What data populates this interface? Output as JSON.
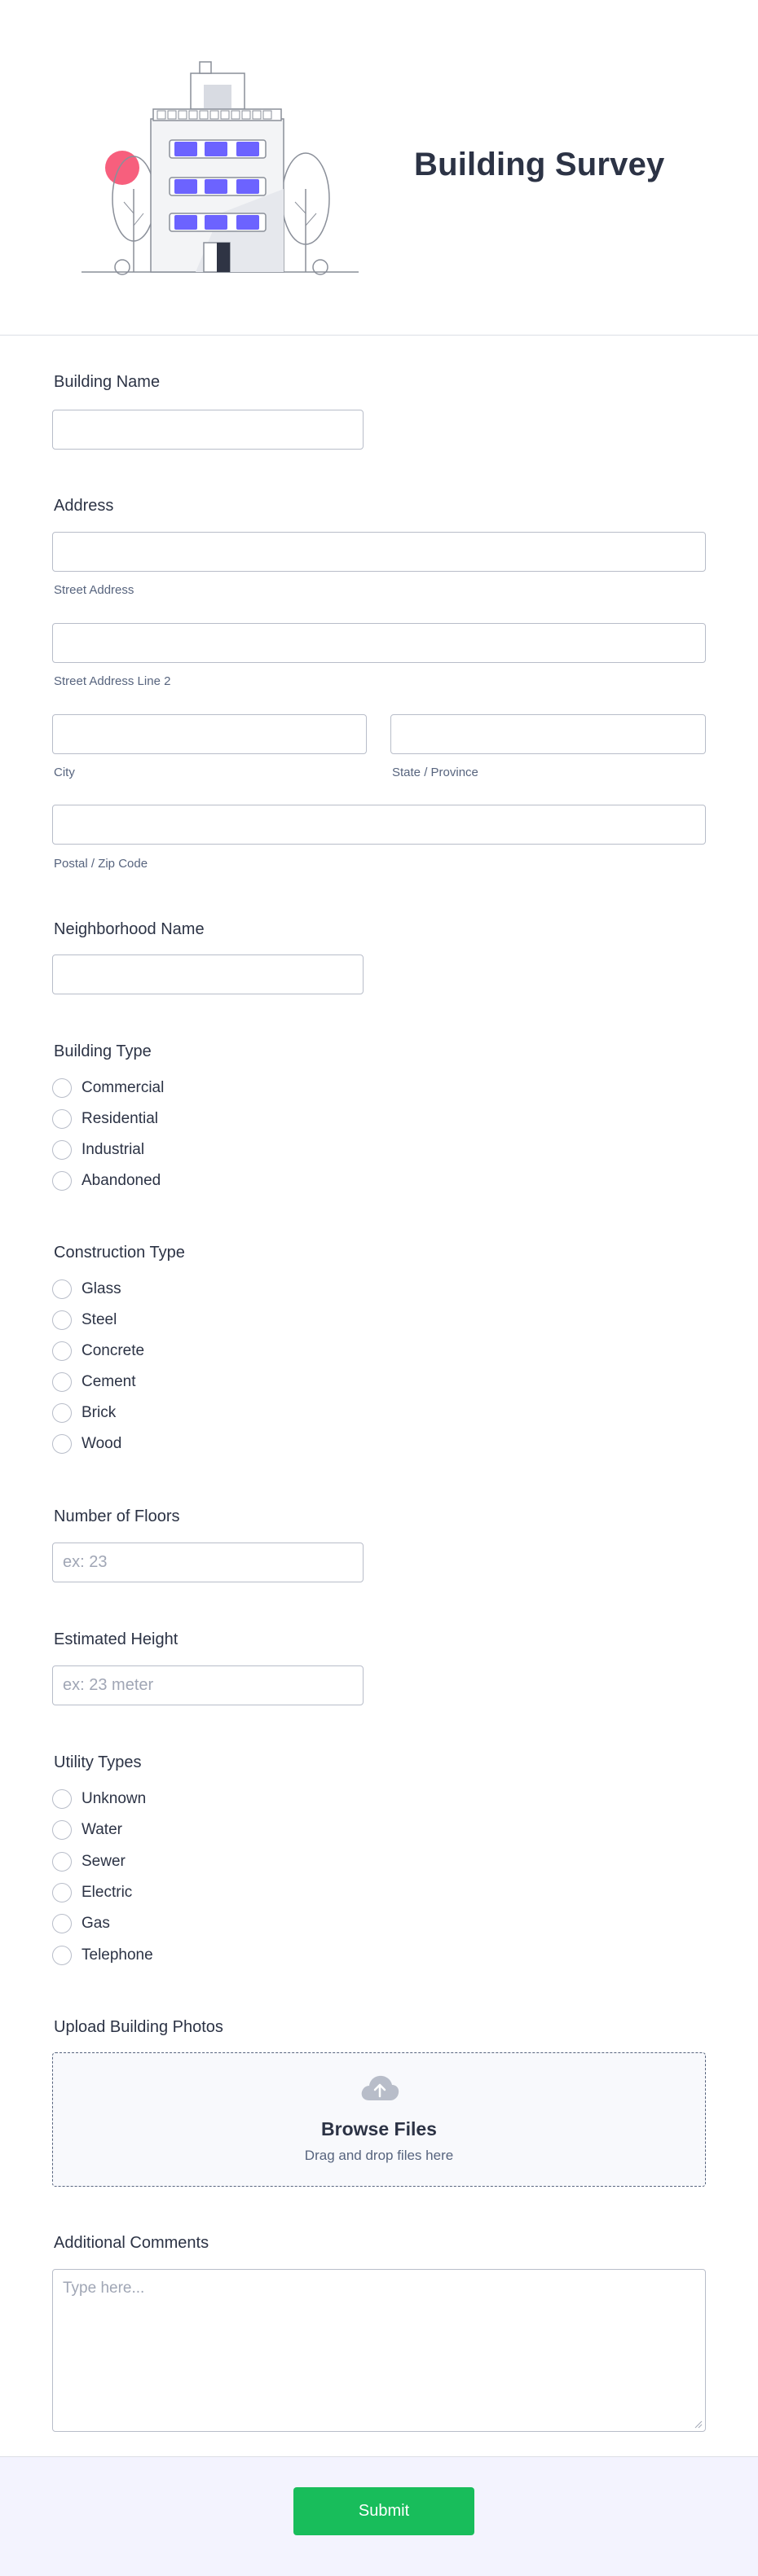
{
  "header": {
    "title": "Building Survey",
    "illustration": "building-illustration"
  },
  "fields": {
    "building_name": {
      "label": "Building Name",
      "value": ""
    },
    "address": {
      "label": "Address",
      "street": "Street Address",
      "street2": "Street Address Line 2",
      "city": "City",
      "state": "State / Province",
      "postal": "Postal / Zip Code"
    },
    "neighborhood": {
      "label": "Neighborhood Name",
      "value": ""
    },
    "building_type": {
      "label": "Building Type",
      "options": [
        "Commercial",
        "Residential",
        "Industrial",
        "Abandoned"
      ]
    },
    "construction_type": {
      "label": "Construction Type",
      "options": [
        "Glass",
        "Steel",
        "Concrete",
        "Cement",
        "Brick",
        "Wood"
      ]
    },
    "floors": {
      "label": "Number of Floors",
      "placeholder": "ex: 23"
    },
    "height": {
      "label": "Estimated Height",
      "placeholder": "ex: 23 meter"
    },
    "utility_types": {
      "label": "Utility Types",
      "options": [
        "Unknown",
        "Water",
        "Sewer",
        "Electric",
        "Gas",
        "Telephone"
      ]
    },
    "upload": {
      "label": "Upload Building Photos",
      "button": "Browse Files",
      "hint": "Drag and drop files here",
      "icon": "cloud-upload-icon"
    },
    "comments": {
      "label": "Additional Comments",
      "placeholder": "Type here..."
    }
  },
  "submit": {
    "label": "Submit"
  },
  "colors": {
    "accent": "#18bd5b",
    "text": "#2c3345",
    "window": "#6c63ff",
    "sun": "#f75f7d"
  }
}
